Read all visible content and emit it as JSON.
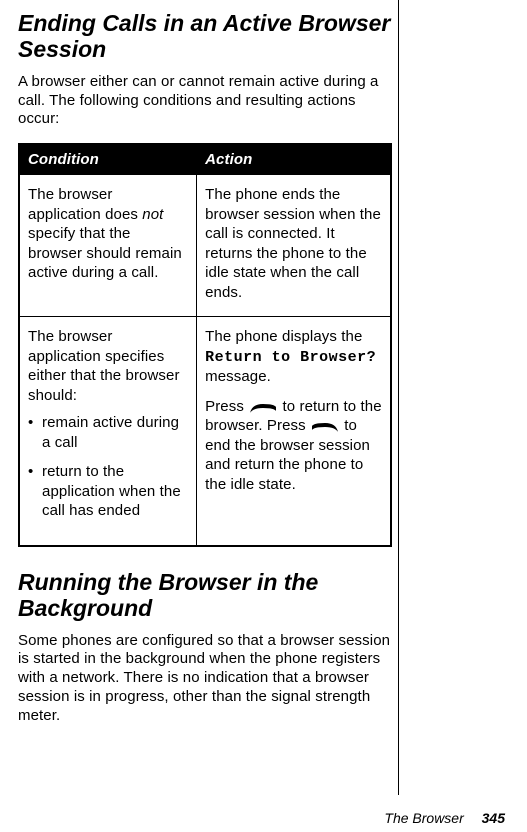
{
  "heading1": "Ending Calls in an Active Browser Session",
  "intro": "A browser either can or cannot remain active during a call. The following conditions and resulting actions occur:",
  "table": {
    "headers": {
      "col1": "Condition",
      "col2": "Action"
    },
    "rows": [
      {
        "condition": {
          "pre": "The browser application does ",
          "em": "not",
          "post": " specify that the browser should remain active during a call."
        },
        "action_plain": "The phone ends the browser session when the call is connected. It returns the phone to the idle state when the call ends."
      },
      {
        "condition": {
          "lead": "The browser application specifies either that the browser should:",
          "bullets": [
            "remain active during a call",
            "return to the application when the call has ended"
          ]
        },
        "action": {
          "line1_pre": "The phone displays the ",
          "ui": "Return to Browser?",
          "line1_post": " message.",
          "line2_a": "Press ",
          "line2_b": " to return to the browser. Press ",
          "line2_c": " to end the browser session and return the phone to the idle state."
        }
      }
    ]
  },
  "heading2": "Running the Browser in the Background",
  "body2": "Some phones are configured so that a browser session is started in the background when the phone registers with a network. There is no indication that a browser session is in progress, other than the signal strength meter.",
  "footer": {
    "section": "The Browser",
    "page": "345"
  },
  "icons": {
    "left_key": "left-soft-key-icon",
    "right_key": "right-soft-key-icon"
  }
}
